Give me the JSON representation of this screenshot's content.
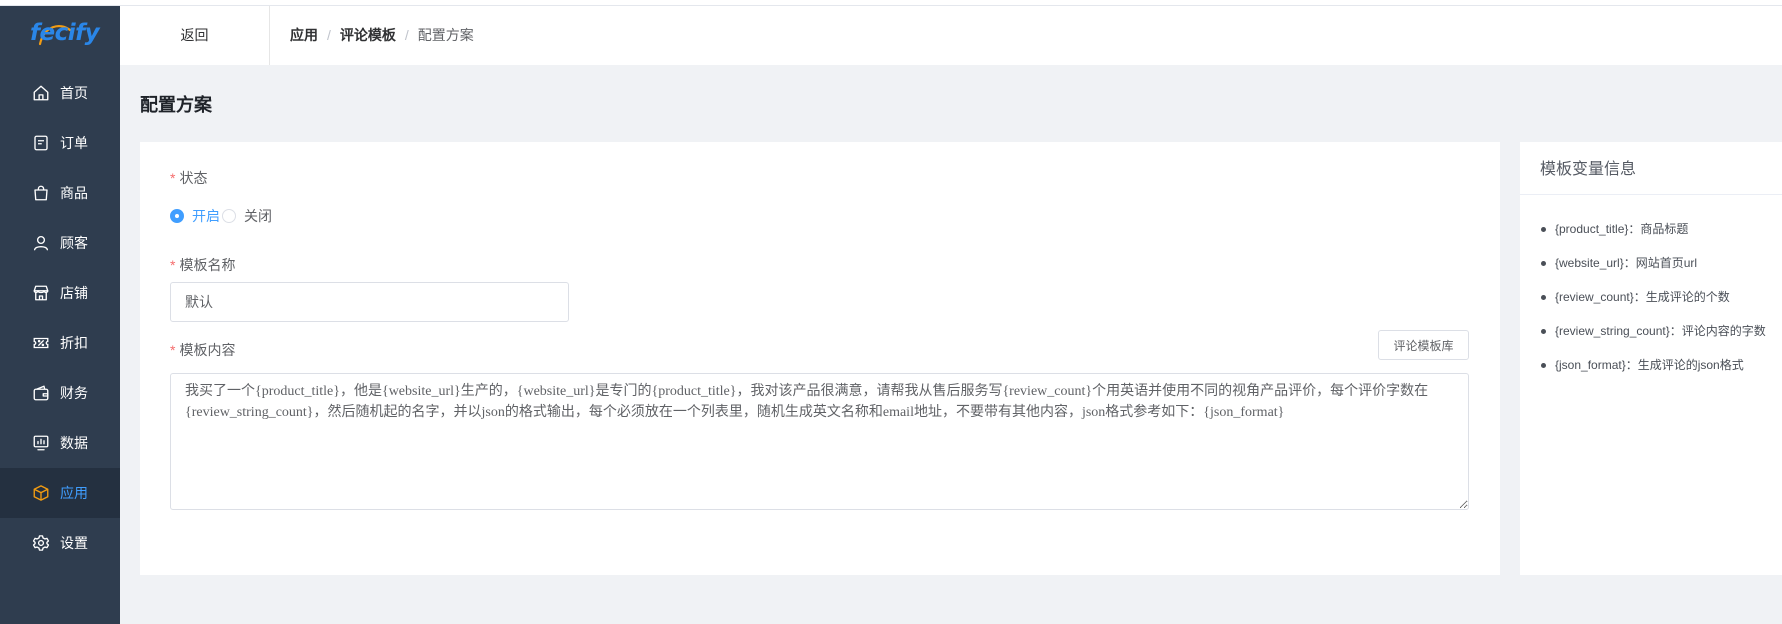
{
  "logo": {
    "text": "fecify"
  },
  "sidebar": {
    "active_index": 8,
    "items": [
      {
        "label": "首页",
        "icon": "home-icon"
      },
      {
        "label": "订单",
        "icon": "order-icon"
      },
      {
        "label": "商品",
        "icon": "shopping-bag-icon"
      },
      {
        "label": "顾客",
        "icon": "user-icon"
      },
      {
        "label": "店铺",
        "icon": "store-icon"
      },
      {
        "label": "折扣",
        "icon": "discount-ticket-icon"
      },
      {
        "label": "财务",
        "icon": "wallet-icon"
      },
      {
        "label": "数据",
        "icon": "chart-monitor-icon"
      },
      {
        "label": "应用",
        "icon": "cube-icon"
      },
      {
        "label": "设置",
        "icon": "gear-icon"
      }
    ]
  },
  "header": {
    "back_label": "返回",
    "separator": "/",
    "breadcrumb": [
      "应用",
      "评论模板",
      "配置方案"
    ]
  },
  "page": {
    "title": "配置方案"
  },
  "form": {
    "required_mark": "*",
    "status": {
      "label": "状态",
      "options": [
        {
          "label": "开启",
          "checked": true
        },
        {
          "label": "关闭",
          "checked": false
        }
      ]
    },
    "template_name": {
      "label": "模板名称",
      "value": "默认"
    },
    "template_content": {
      "label": "模板内容",
      "library_button": "评论模板库",
      "value": "我买了一个{product_title}，他是{website_url}生产的，{website_url}是专门的{product_title}，我对该产品很满意，请帮我从售后服务写{review_count}个用英语并使用不同的视角产品评价，每个评价字数在{review_string_count}，然后随机起的名字，并以json的格式输出，每个必须放在一个列表里，随机生成英文名称和email地址，不要带有其他内容，json格式参考如下：{json_format}"
    }
  },
  "variables_panel": {
    "title": "模板变量信息",
    "items": [
      "{product_title}：商品标题",
      "{website_url}：网站首页url",
      "{review_count}：生成评论的个数",
      "{review_string_count}：评论内容的字数",
      "{json_format}：生成评论的json格式"
    ]
  },
  "colors": {
    "sidebar_bg": "#2f3d4f",
    "sidebar_active_bg": "#243040",
    "accent": "#409eff",
    "active_icon": "#f39c12",
    "required": "#f56c6c",
    "page_bg": "#f0f2f5"
  }
}
